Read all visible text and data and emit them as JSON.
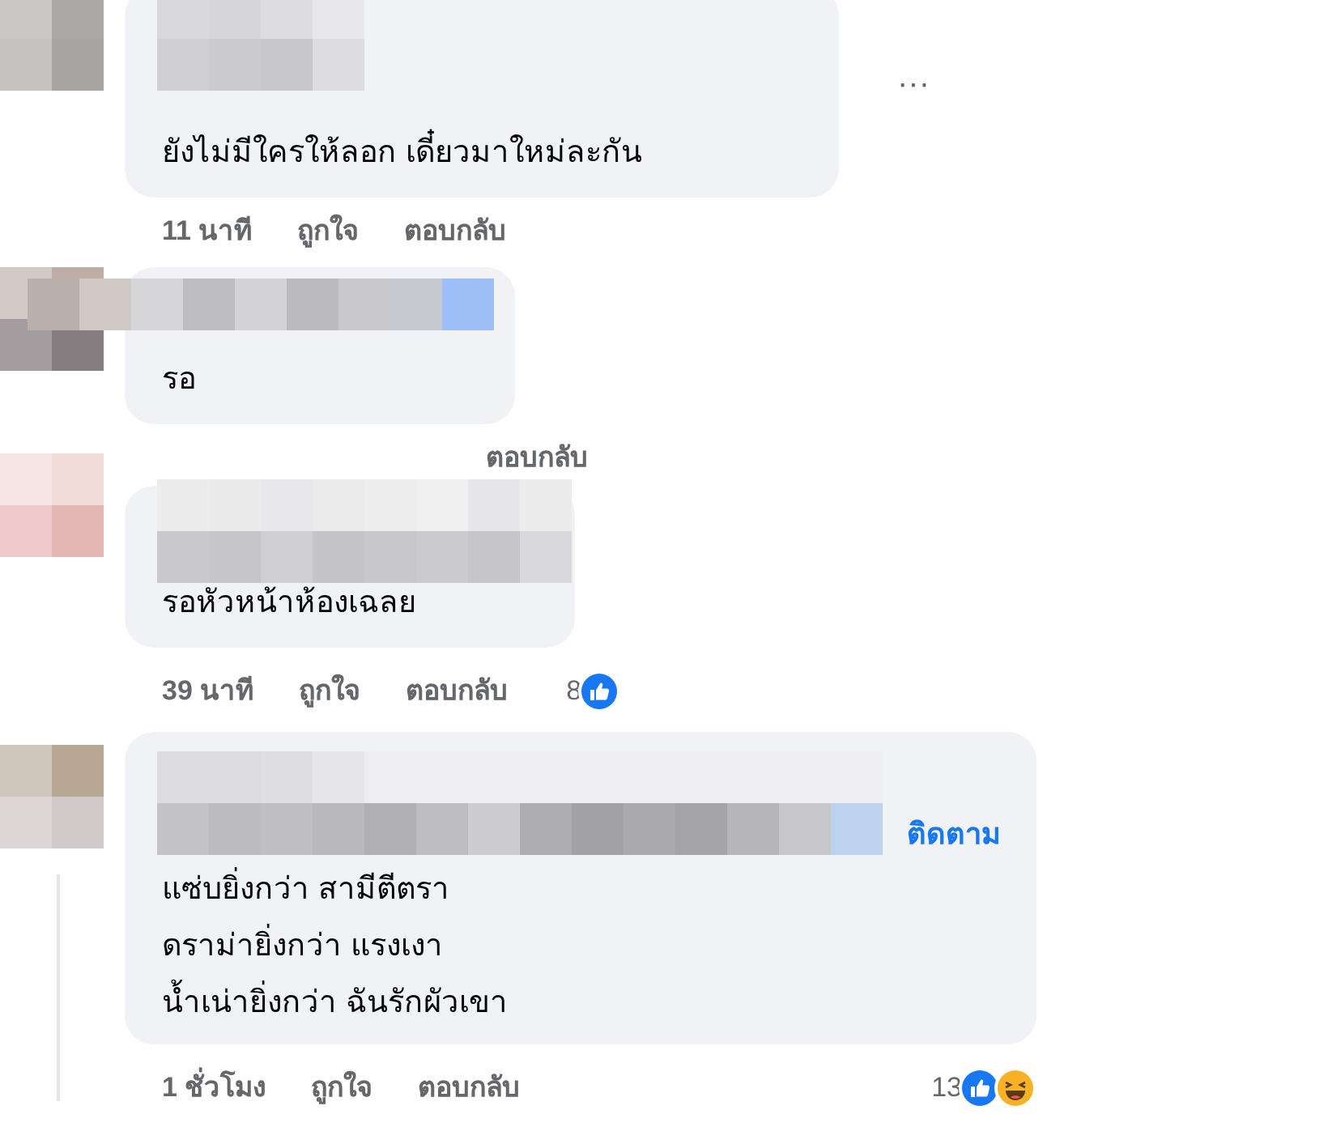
{
  "comments": [
    {
      "lines": [
        "ยังไม่มีใครให้ลอก เดี๋ยวมาใหม่ละกัน"
      ],
      "more": "···",
      "meta": {
        "time": "11 นาที",
        "like": "ถูกใจ",
        "reply": "ตอบกลับ"
      }
    },
    {
      "lines": [
        "รอ"
      ],
      "meta": {
        "reply": "ตอบกลับ"
      }
    },
    {
      "lines": [
        "รอหัวหน้าห้องเฉลย"
      ],
      "meta": {
        "time": "39 นาที",
        "like": "ถูกใจ",
        "reply": "ตอบกลับ"
      },
      "reactions": {
        "count": "8",
        "kinds": [
          {
            "kind": "like"
          }
        ]
      }
    },
    {
      "lines": [
        "แซ่บยิ่งกว่า สามีตีตรา",
        "ดราม่ายิ่งกว่า แรงเงา",
        "น้ำเน่ายิ่งกว่า ฉันรักผัวเขา"
      ],
      "follow": "ติดตาม",
      "meta": {
        "time": "1 ชั่วโมง",
        "like": "ถูกใจ",
        "reply": "ตอบกลับ"
      },
      "reactions": {
        "count": "13",
        "kinds": [
          {
            "kind": "like"
          },
          {
            "kind": "haha"
          }
        ]
      }
    }
  ]
}
